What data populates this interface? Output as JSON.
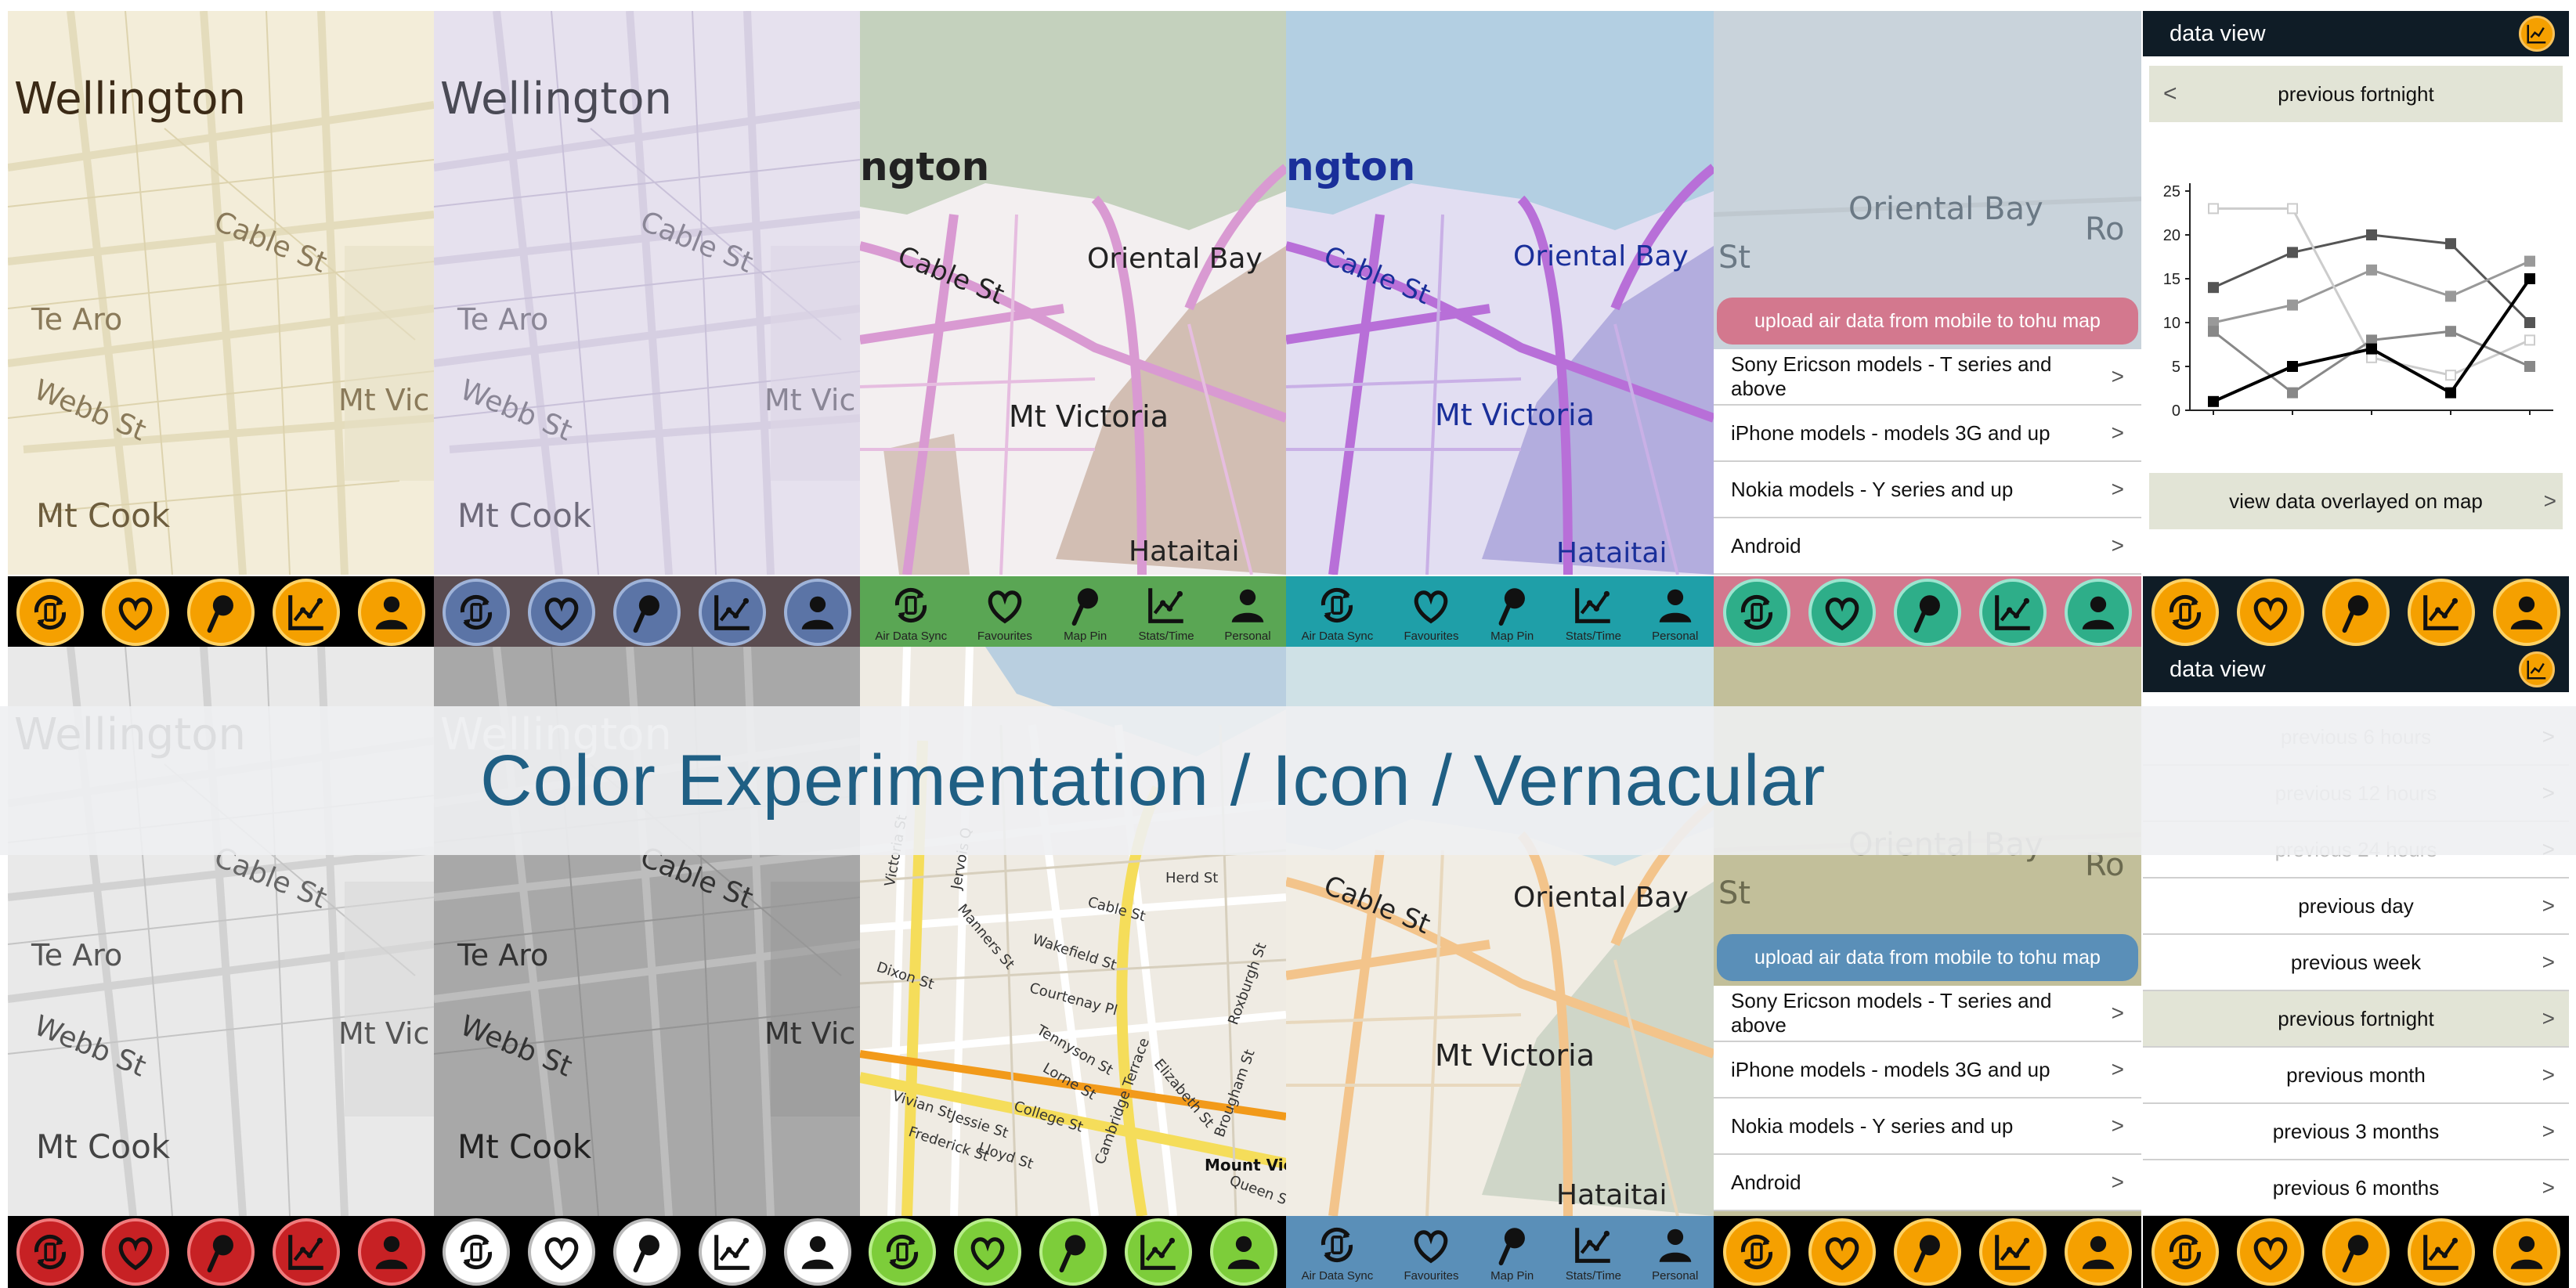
{
  "banner": {
    "title": "Color Experimentation / Icon / Vernacular"
  },
  "map_labels": {
    "wellington": "Wellington",
    "cable_st": "Cable St",
    "te_aro": "Te Aro",
    "webb_st": "Webb St",
    "mt_vic_cut": "Mt Vic",
    "mt_cook": "Mt Cook",
    "ngton": "ngton",
    "oriental_bay": "Oriental Bay",
    "mt_victoria": "Mt Victoria",
    "hataitai": "Hataitai",
    "st": "St",
    "ro": "Ro",
    "herd_st": "Herd St",
    "cable_st_small": "Cable St",
    "wakefield_st": "Wakefield St",
    "courtenay_pl": "Courtenay Pl",
    "tennyson_st": "Tennyson St",
    "cambridge_terrace": "Cambridge Terrace",
    "elizabeth_st": "Elizabeth St",
    "brougham_st": "Brougham St",
    "vivian_st": "Vivian St",
    "jessie_st": "Jessie St",
    "college_st": "College St",
    "mount_vic": "Mount Vic",
    "queen_st": "Queen St",
    "frederick_st": "Frederick St",
    "roxburgh_st": "Roxburgh St",
    "manners_st": "Manners St",
    "dixon_st": "Dixon St",
    "victoria_st": "Victoria St",
    "jervois_q": "Jervois Q",
    "lorne_st": "Lorne St",
    "lloyd_st": "Lloyd St"
  },
  "toolbar_labels": [
    "Air Data Sync",
    "Favourites",
    "Map Pin",
    "Stats/Time",
    "Personal"
  ],
  "icons": [
    "sync-icon",
    "heart-icon",
    "map-pin-icon",
    "stats-icon",
    "person-icon"
  ],
  "upload_menu": {
    "upload_label": "upload air data from mobile to tohu map",
    "items": [
      "Sony Ericson models - T series and above",
      "iPhone models - models 3G and up",
      "Nokia models - Y series and up",
      "Android"
    ],
    "chevron": ">"
  },
  "data_view_top": {
    "header": "data view",
    "period": "previous fortnight",
    "back": "<",
    "footer_button": "view data overlayed on map",
    "chart_data": {
      "type": "line",
      "ylim": [
        0,
        25
      ],
      "yticks": [
        0,
        5,
        10,
        15,
        20,
        25
      ],
      "x": [
        1,
        2,
        3,
        4,
        5
      ],
      "series": [
        {
          "values": [
            14,
            18,
            20,
            19,
            10
          ],
          "color": "#555555"
        },
        {
          "values": [
            10,
            12,
            16,
            13,
            17
          ],
          "color": "#999999"
        },
        {
          "values": [
            23,
            23,
            6,
            4,
            8
          ],
          "color": "#cccccc"
        },
        {
          "values": [
            9,
            2,
            8,
            9,
            5
          ],
          "color": "#888888"
        },
        {
          "values": [
            1,
            5,
            7,
            2,
            15
          ],
          "color": "#000000"
        }
      ]
    }
  },
  "data_view_bottom": {
    "header": "data view",
    "items": [
      "previous 6 hours",
      "previous 12 hours",
      "previous 24 hours",
      "previous day",
      "previous week",
      "previous fortnight",
      "previous month",
      "previous 3 months",
      "previous 6 months"
    ]
  },
  "colors": {
    "accent_title": "#1f5f84",
    "orange": "#f5a000",
    "dark": "#0f1c26",
    "pink": "#d3788e",
    "teal": "#1f9fa8",
    "green": "#5aa654",
    "blue_bar": "#5a8fb8",
    "red": "#c72124"
  }
}
